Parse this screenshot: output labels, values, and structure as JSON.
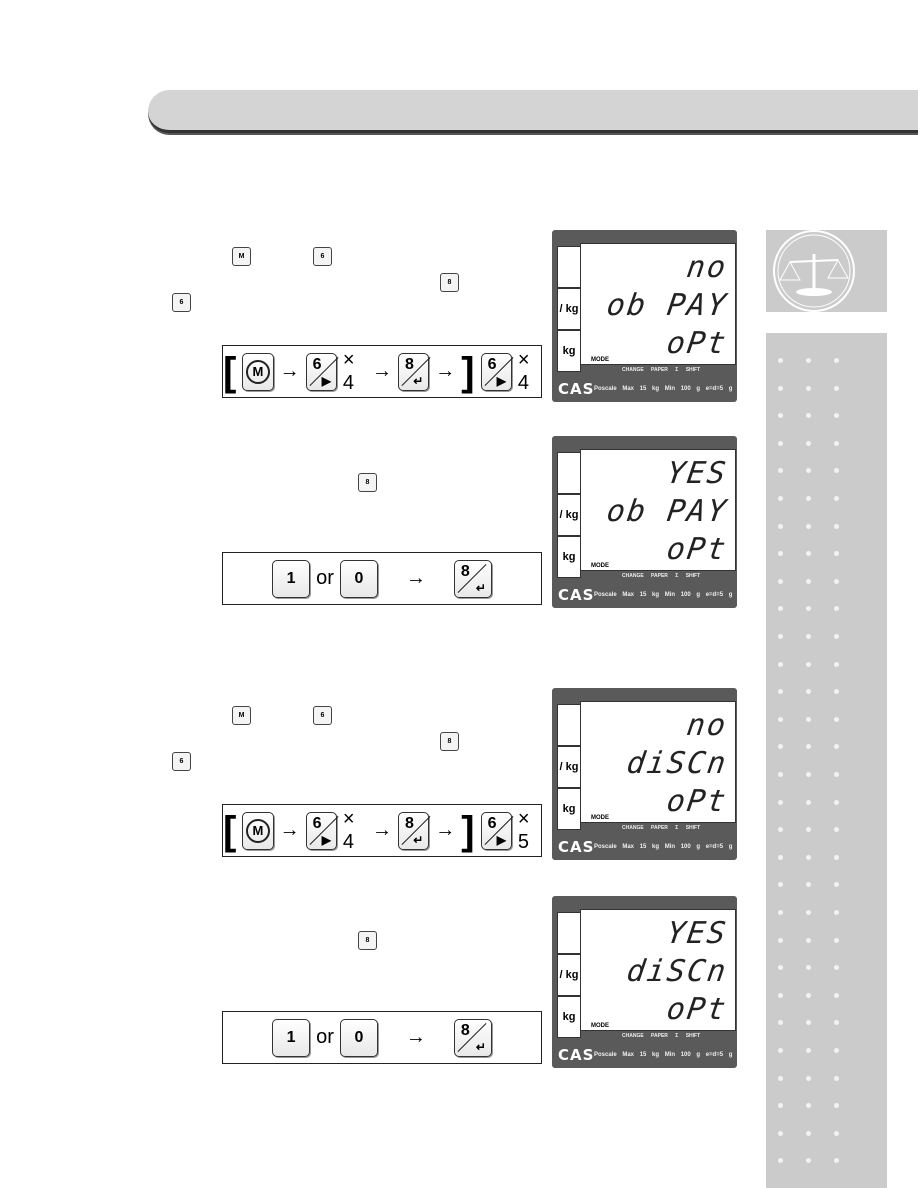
{
  "colors": {
    "lcd_body": "#5a5a5a",
    "sidebar": "#cbcbcb",
    "header": "#d4d4d4"
  },
  "icons": {
    "logo": "scale-of-justice-icon",
    "mode": "mode-key-icon",
    "key6": "key-6-right-icon",
    "key8": "key-8-enter-icon"
  },
  "lcd_common": {
    "cell_unit": "/ kg",
    "cell_kg": "kg",
    "mode": "MODE",
    "annunciators": "CHANGE PAPER Σ SHIFT",
    "brand": "CAS",
    "footer": "Poscale  Max 15 kg  Min 100 g  e=d=5 g"
  },
  "sections": [
    {
      "lcd": [
        "no",
        "ob PAY",
        "oPt"
      ],
      "sequence": {
        "type": "menu",
        "count_inside": "× 4",
        "count_after": "× 4"
      }
    },
    {
      "lcd": [
        "YES",
        "ob PAY",
        "oPt"
      ],
      "sequence": {
        "type": "choice",
        "a": "1",
        "or": "or",
        "b": "0"
      }
    },
    {
      "lcd": [
        "no",
        "diSCn",
        "oPt"
      ],
      "sequence": {
        "type": "menu",
        "count_inside": "× 4",
        "count_after": "× 5"
      }
    },
    {
      "lcd": [
        "YES",
        "diSCn",
        "oPt"
      ],
      "sequence": {
        "type": "choice",
        "a": "1",
        "or": "or",
        "b": "0"
      }
    }
  ],
  "keys": {
    "mode": "M",
    "k6_top": "6",
    "k6_bottom": "▶",
    "k8_top": "8",
    "k8_bottom": "↵",
    "arrow": "→",
    "bracket_open": "[",
    "bracket_close": "]"
  }
}
